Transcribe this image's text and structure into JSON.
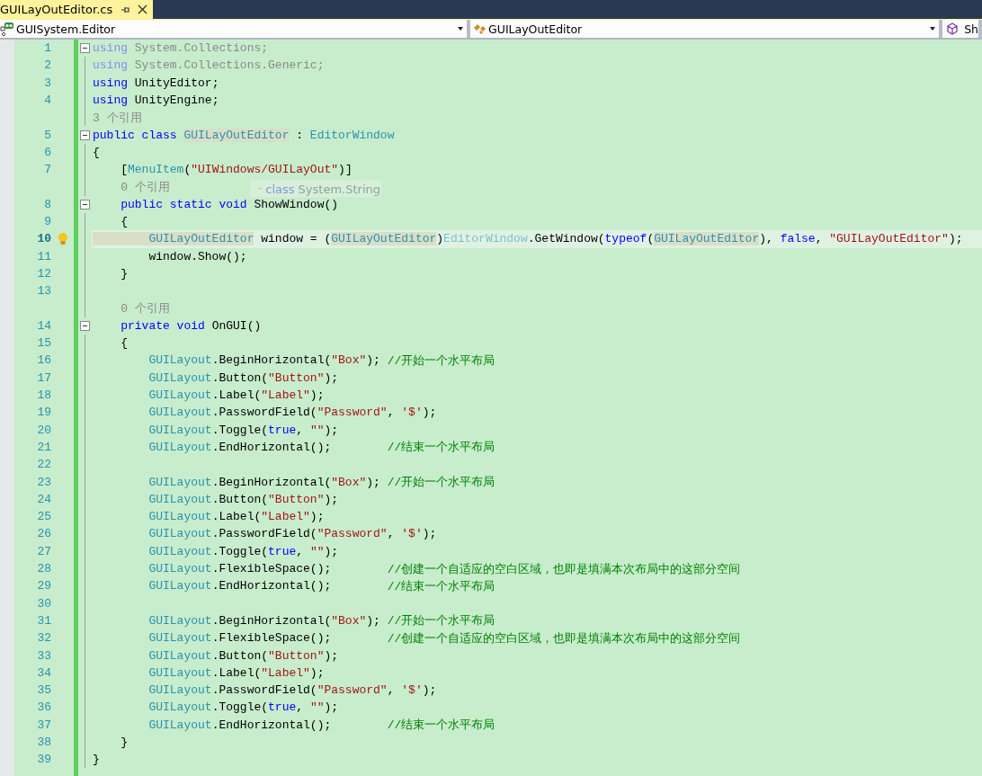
{
  "tabs": [
    {
      "label": "GUILayOutEditor.cs",
      "selected": true
    }
  ],
  "nav_bar": [
    {
      "label": "GUISystem.Editor",
      "kind": "namespace"
    },
    {
      "label": "GUILayOutEditor",
      "kind": "class"
    },
    {
      "label": "Sh",
      "kind": "member"
    }
  ],
  "editor": {
    "lines": [
      {
        "kind": "code",
        "number": "1",
        "fold": true,
        "current": false,
        "tokens": [
          {
            "kind": "faded_kw",
            "text": "using"
          },
          {
            "kind": "faded",
            "text": " System.Collections;"
          }
        ]
      },
      {
        "kind": "code",
        "number": "2",
        "fold": false,
        "current": false,
        "tokens": [
          {
            "kind": "faded_kw",
            "text": "using"
          },
          {
            "kind": "faded",
            "text": " System.Collections.Generic;"
          }
        ]
      },
      {
        "kind": "code",
        "number": "3",
        "fold": false,
        "current": false,
        "tokens": [
          {
            "kind": "kw",
            "text": "using"
          },
          {
            "kind": "plain",
            "text": " UnityEditor;"
          }
        ]
      },
      {
        "kind": "code",
        "number": "4",
        "fold": false,
        "current": false,
        "tokens": [
          {
            "kind": "kw",
            "text": "using"
          },
          {
            "kind": "plain",
            "text": " UnityEngine;"
          }
        ]
      },
      {
        "kind": "codelens",
        "text": "3 个引用"
      },
      {
        "kind": "code",
        "number": "5",
        "fold": true,
        "current": false,
        "tokens": [
          {
            "kind": "kw",
            "text": "public class "
          },
          {
            "kind": "type_ref",
            "text": "GUILayOutEditor"
          },
          {
            "kind": "plain",
            "text": " : "
          },
          {
            "kind": "type",
            "text": "EditorWindow"
          }
        ]
      },
      {
        "kind": "code",
        "number": "6",
        "fold": false,
        "current": false,
        "tokens": [
          {
            "kind": "plain",
            "text": "{"
          }
        ]
      },
      {
        "kind": "code",
        "number": "7",
        "fold": false,
        "current": false,
        "tokens": [
          {
            "kind": "plain",
            "text": "    ["
          },
          {
            "kind": "type",
            "text": "MenuItem"
          },
          {
            "kind": "plain",
            "text": "("
          },
          {
            "kind": "str",
            "text": "\"UIWindows/GUILayOut\""
          },
          {
            "kind": "plain",
            "text": ")]"
          }
        ]
      },
      {
        "kind": "codelens",
        "text": "    0 个引用"
      },
      {
        "kind": "code",
        "number": "8",
        "fold": true,
        "current": false,
        "tokens": [
          {
            "kind": "kw",
            "text": "    public static void"
          },
          {
            "kind": "plain",
            "text": " ShowWindow()"
          }
        ]
      },
      {
        "kind": "code",
        "number": "9",
        "fold": false,
        "current": false,
        "tokens": [
          {
            "kind": "plain",
            "text": "    {"
          }
        ]
      },
      {
        "kind": "code",
        "number": "10",
        "fold": false,
        "current": true,
        "tokens": [
          {
            "kind": "type_ref",
            "text": "        GUILayOutEditor"
          },
          {
            "kind": "plain",
            "text": " window = ("
          },
          {
            "kind": "type_ref",
            "text": "GUILayOutEditor"
          },
          {
            "kind": "plain",
            "text": ")"
          },
          {
            "kind": "faded_type",
            "text": "EditorWindow"
          },
          {
            "kind": "plain",
            "text": ".GetWindow("
          },
          {
            "kind": "kw",
            "text": "typeof"
          },
          {
            "kind": "plain",
            "text": "("
          },
          {
            "kind": "type_ref",
            "text": "GUILayOutEditor"
          },
          {
            "kind": "plain",
            "text": "), "
          },
          {
            "kind": "kw",
            "text": "false"
          },
          {
            "kind": "plain",
            "text": ", "
          },
          {
            "kind": "str",
            "text": "\"GUILayOutEditor\""
          },
          {
            "kind": "plain",
            "text": ");"
          }
        ]
      },
      {
        "kind": "code",
        "number": "11",
        "fold": false,
        "current": false,
        "tokens": [
          {
            "kind": "plain",
            "text": "        window.Show();"
          }
        ]
      },
      {
        "kind": "code",
        "number": "12",
        "fold": false,
        "current": false,
        "tokens": [
          {
            "kind": "plain",
            "text": "    }"
          }
        ]
      },
      {
        "kind": "code",
        "number": "13",
        "fold": false,
        "current": false
      },
      {
        "kind": "codelens",
        "text": "    0 个引用"
      },
      {
        "kind": "code",
        "number": "14",
        "fold": true,
        "current": false,
        "tokens": [
          {
            "kind": "kw",
            "text": "    private void"
          },
          {
            "kind": "plain",
            "text": " OnGUI()"
          }
        ]
      },
      {
        "kind": "code",
        "number": "15",
        "fold": false,
        "current": false,
        "tokens": [
          {
            "kind": "plain",
            "text": "    {"
          }
        ]
      },
      {
        "kind": "code",
        "number": "16",
        "fold": false,
        "current": false,
        "tokens": [
          {
            "kind": "type",
            "text": "        GUILayout"
          },
          {
            "kind": "plain",
            "text": ".BeginHorizontal("
          },
          {
            "kind": "str",
            "text": "\"Box\""
          },
          {
            "kind": "plain",
            "text": "); "
          },
          {
            "kind": "comment",
            "text": "//开始一个水平布局"
          }
        ]
      },
      {
        "kind": "code",
        "number": "17",
        "fold": false,
        "current": false,
        "tokens": [
          {
            "kind": "type",
            "text": "        GUILayout"
          },
          {
            "kind": "plain",
            "text": ".Button("
          },
          {
            "kind": "str",
            "text": "\"Button\""
          },
          {
            "kind": "plain",
            "text": ");"
          }
        ]
      },
      {
        "kind": "code",
        "number": "18",
        "fold": false,
        "current": false,
        "tokens": [
          {
            "kind": "type",
            "text": "        GUILayout"
          },
          {
            "kind": "plain",
            "text": ".Label("
          },
          {
            "kind": "str",
            "text": "\"Label\""
          },
          {
            "kind": "plain",
            "text": ");"
          }
        ]
      },
      {
        "kind": "code",
        "number": "19",
        "fold": false,
        "current": false,
        "tokens": [
          {
            "kind": "type",
            "text": "        GUILayout"
          },
          {
            "kind": "plain",
            "text": ".PasswordField("
          },
          {
            "kind": "str",
            "text": "\"Password\""
          },
          {
            "kind": "plain",
            "text": ", "
          },
          {
            "kind": "str",
            "text": "'$'"
          },
          {
            "kind": "plain",
            "text": ");"
          }
        ]
      },
      {
        "kind": "code",
        "number": "20",
        "fold": false,
        "current": false,
        "tokens": [
          {
            "kind": "type",
            "text": "        GUILayout"
          },
          {
            "kind": "plain",
            "text": ".Toggle("
          },
          {
            "kind": "kw",
            "text": "true"
          },
          {
            "kind": "plain",
            "text": ", "
          },
          {
            "kind": "str",
            "text": "\"\""
          },
          {
            "kind": "plain",
            "text": ");"
          }
        ]
      },
      {
        "kind": "code",
        "number": "21",
        "fold": false,
        "current": false,
        "tokens": [
          {
            "kind": "type",
            "text": "        GUILayout"
          },
          {
            "kind": "plain",
            "text": ".EndHorizontal();        "
          },
          {
            "kind": "comment",
            "text": "//结束一个水平布局"
          }
        ]
      },
      {
        "kind": "code",
        "number": "22",
        "fold": false,
        "current": false
      },
      {
        "kind": "code",
        "number": "23",
        "fold": false,
        "current": false,
        "tokens": [
          {
            "kind": "type",
            "text": "        GUILayout"
          },
          {
            "kind": "plain",
            "text": ".BeginHorizontal("
          },
          {
            "kind": "str",
            "text": "\"Box\""
          },
          {
            "kind": "plain",
            "text": "); "
          },
          {
            "kind": "comment",
            "text": "//开始一个水平布局"
          }
        ]
      },
      {
        "kind": "code",
        "number": "24",
        "fold": false,
        "current": false,
        "tokens": [
          {
            "kind": "type",
            "text": "        GUILayout"
          },
          {
            "kind": "plain",
            "text": ".Button("
          },
          {
            "kind": "str",
            "text": "\"Button\""
          },
          {
            "kind": "plain",
            "text": ");"
          }
        ]
      },
      {
        "kind": "code",
        "number": "25",
        "fold": false,
        "current": false,
        "tokens": [
          {
            "kind": "type",
            "text": "        GUILayout"
          },
          {
            "kind": "plain",
            "text": ".Label("
          },
          {
            "kind": "str",
            "text": "\"Label\""
          },
          {
            "kind": "plain",
            "text": ");"
          }
        ]
      },
      {
        "kind": "code",
        "number": "26",
        "fold": false,
        "current": false,
        "tokens": [
          {
            "kind": "type",
            "text": "        GUILayout"
          },
          {
            "kind": "plain",
            "text": ".PasswordField("
          },
          {
            "kind": "str",
            "text": "\"Password\""
          },
          {
            "kind": "plain",
            "text": ", "
          },
          {
            "kind": "str",
            "text": "'$'"
          },
          {
            "kind": "plain",
            "text": ");"
          }
        ]
      },
      {
        "kind": "code",
        "number": "27",
        "fold": false,
        "current": false,
        "tokens": [
          {
            "kind": "type",
            "text": "        GUILayout"
          },
          {
            "kind": "plain",
            "text": ".Toggle("
          },
          {
            "kind": "kw",
            "text": "true"
          },
          {
            "kind": "plain",
            "text": ", "
          },
          {
            "kind": "str",
            "text": "\"\""
          },
          {
            "kind": "plain",
            "text": ");"
          }
        ]
      },
      {
        "kind": "code",
        "number": "28",
        "fold": false,
        "current": false,
        "tokens": [
          {
            "kind": "type",
            "text": "        GUILayout"
          },
          {
            "kind": "plain",
            "text": ".FlexibleSpace();        "
          },
          {
            "kind": "comment",
            "text": "//创建一个自适应的空白区域，也即是填满本次布局中的这部分空间"
          }
        ]
      },
      {
        "kind": "code",
        "number": "29",
        "fold": false,
        "current": false,
        "tokens": [
          {
            "kind": "type",
            "text": "        GUILayout"
          },
          {
            "kind": "plain",
            "text": ".EndHorizontal();        "
          },
          {
            "kind": "comment",
            "text": "//结束一个水平布局"
          }
        ]
      },
      {
        "kind": "code",
        "number": "30",
        "fold": false,
        "current": false
      },
      {
        "kind": "code",
        "number": "31",
        "fold": false,
        "current": false,
        "tokens": [
          {
            "kind": "type",
            "text": "        GUILayout"
          },
          {
            "kind": "plain",
            "text": ".BeginHorizontal("
          },
          {
            "kind": "str",
            "text": "\"Box\""
          },
          {
            "kind": "plain",
            "text": "); "
          },
          {
            "kind": "comment",
            "text": "//开始一个水平布局"
          }
        ]
      },
      {
        "kind": "code",
        "number": "32",
        "fold": false,
        "current": false,
        "tokens": [
          {
            "kind": "type",
            "text": "        GUILayout"
          },
          {
            "kind": "plain",
            "text": ".FlexibleSpace();        "
          },
          {
            "kind": "comment",
            "text": "//创建一个自适应的空白区域，也即是填满本次布局中的这部分空间"
          }
        ]
      },
      {
        "kind": "code",
        "number": "33",
        "fold": false,
        "current": false,
        "tokens": [
          {
            "kind": "type",
            "text": "        GUILayout"
          },
          {
            "kind": "plain",
            "text": ".Button("
          },
          {
            "kind": "str",
            "text": "\"Button\""
          },
          {
            "kind": "plain",
            "text": ");"
          }
        ]
      },
      {
        "kind": "code",
        "number": "34",
        "fold": false,
        "current": false,
        "tokens": [
          {
            "kind": "type",
            "text": "        GUILayout"
          },
          {
            "kind": "plain",
            "text": ".Label("
          },
          {
            "kind": "str",
            "text": "\"Label\""
          },
          {
            "kind": "plain",
            "text": ");"
          }
        ]
      },
      {
        "kind": "code",
        "number": "35",
        "fold": false,
        "current": false,
        "tokens": [
          {
            "kind": "type",
            "text": "        GUILayout"
          },
          {
            "kind": "plain",
            "text": ".PasswordField("
          },
          {
            "kind": "str",
            "text": "\"Password\""
          },
          {
            "kind": "plain",
            "text": ", "
          },
          {
            "kind": "str",
            "text": "'$'"
          },
          {
            "kind": "plain",
            "text": ");"
          }
        ]
      },
      {
        "kind": "code",
        "number": "36",
        "fold": false,
        "current": false,
        "tokens": [
          {
            "kind": "type",
            "text": "        GUILayout"
          },
          {
            "kind": "plain",
            "text": ".Toggle("
          },
          {
            "kind": "kw",
            "text": "true"
          },
          {
            "kind": "plain",
            "text": ", "
          },
          {
            "kind": "str",
            "text": "\"\""
          },
          {
            "kind": "plain",
            "text": ");"
          }
        ]
      },
      {
        "kind": "code",
        "number": "37",
        "fold": false,
        "current": false,
        "tokens": [
          {
            "kind": "type",
            "text": "        GUILayout"
          },
          {
            "kind": "plain",
            "text": ".EndHorizontal();        "
          },
          {
            "kind": "comment",
            "text": "//结束一个水平布局"
          }
        ]
      },
      {
        "kind": "code",
        "number": "38",
        "fold": false,
        "current": false,
        "tokens": [
          {
            "kind": "plain",
            "text": "    }"
          }
        ]
      },
      {
        "kind": "code",
        "number": "39",
        "fold": false,
        "current": false,
        "tokens": [
          {
            "kind": "plain",
            "text": "}"
          }
        ]
      }
    ],
    "tooltip": {
      "keyword": "class",
      "text": "System.String"
    }
  }
}
